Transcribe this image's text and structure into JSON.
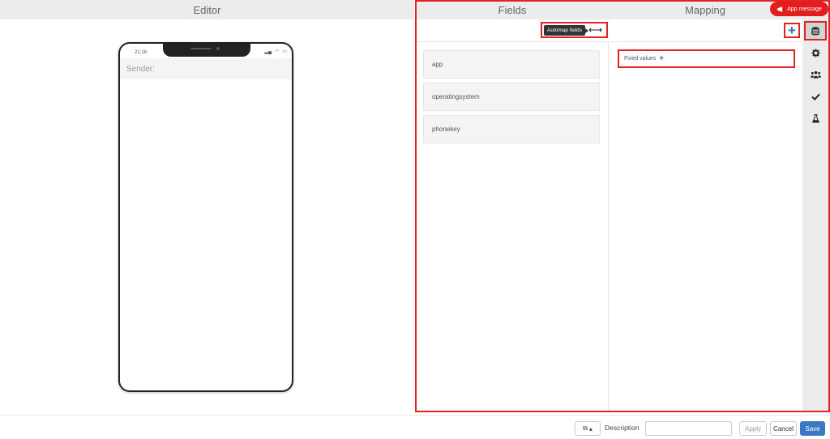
{
  "editor": {
    "header": "Editor",
    "phone": {
      "time": "21:18",
      "sender_label": "Sender:"
    }
  },
  "fields": {
    "header": "Fields",
    "automap_label": "Automap fields",
    "items": [
      {
        "label": "app"
      },
      {
        "label": "operatingsystem"
      },
      {
        "label": "phonekey"
      }
    ]
  },
  "mapping": {
    "header": "Mapping",
    "fixed_values_label": "Fixed values"
  },
  "app_message": {
    "label": "App message"
  },
  "sidebar": {
    "icons": [
      "database-icon",
      "gear-icon",
      "users-icon",
      "check-icon",
      "flask-icon"
    ]
  },
  "footer": {
    "description_label": "Description",
    "description_value": "",
    "apply_label": "Apply",
    "cancel_label": "Cancel",
    "save_label": "Save"
  },
  "colors": {
    "highlight": "#e52222",
    "accent": "#3a78c3",
    "brand_red": "#e31d1d"
  }
}
